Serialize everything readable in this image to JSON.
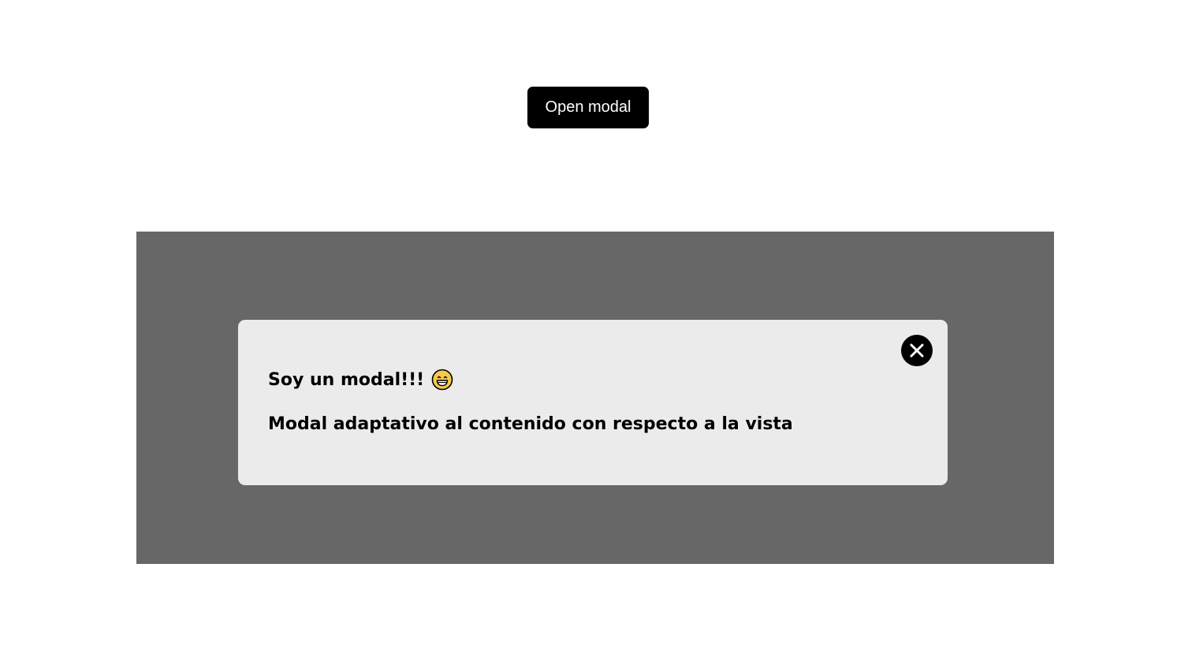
{
  "page": {
    "open_button_label": "Open modal"
  },
  "modal": {
    "title": "Soy un modal!!!",
    "emoji_icon": "grinning-face-icon",
    "body": "Modal adaptativo al contenido con respecto a la vista",
    "close_icon": "close-icon"
  },
  "colors": {
    "button_bg": "#000000",
    "overlay_bg": "#676767",
    "modal_bg": "#ebebeb",
    "emoji_face": "#f7c94c"
  }
}
